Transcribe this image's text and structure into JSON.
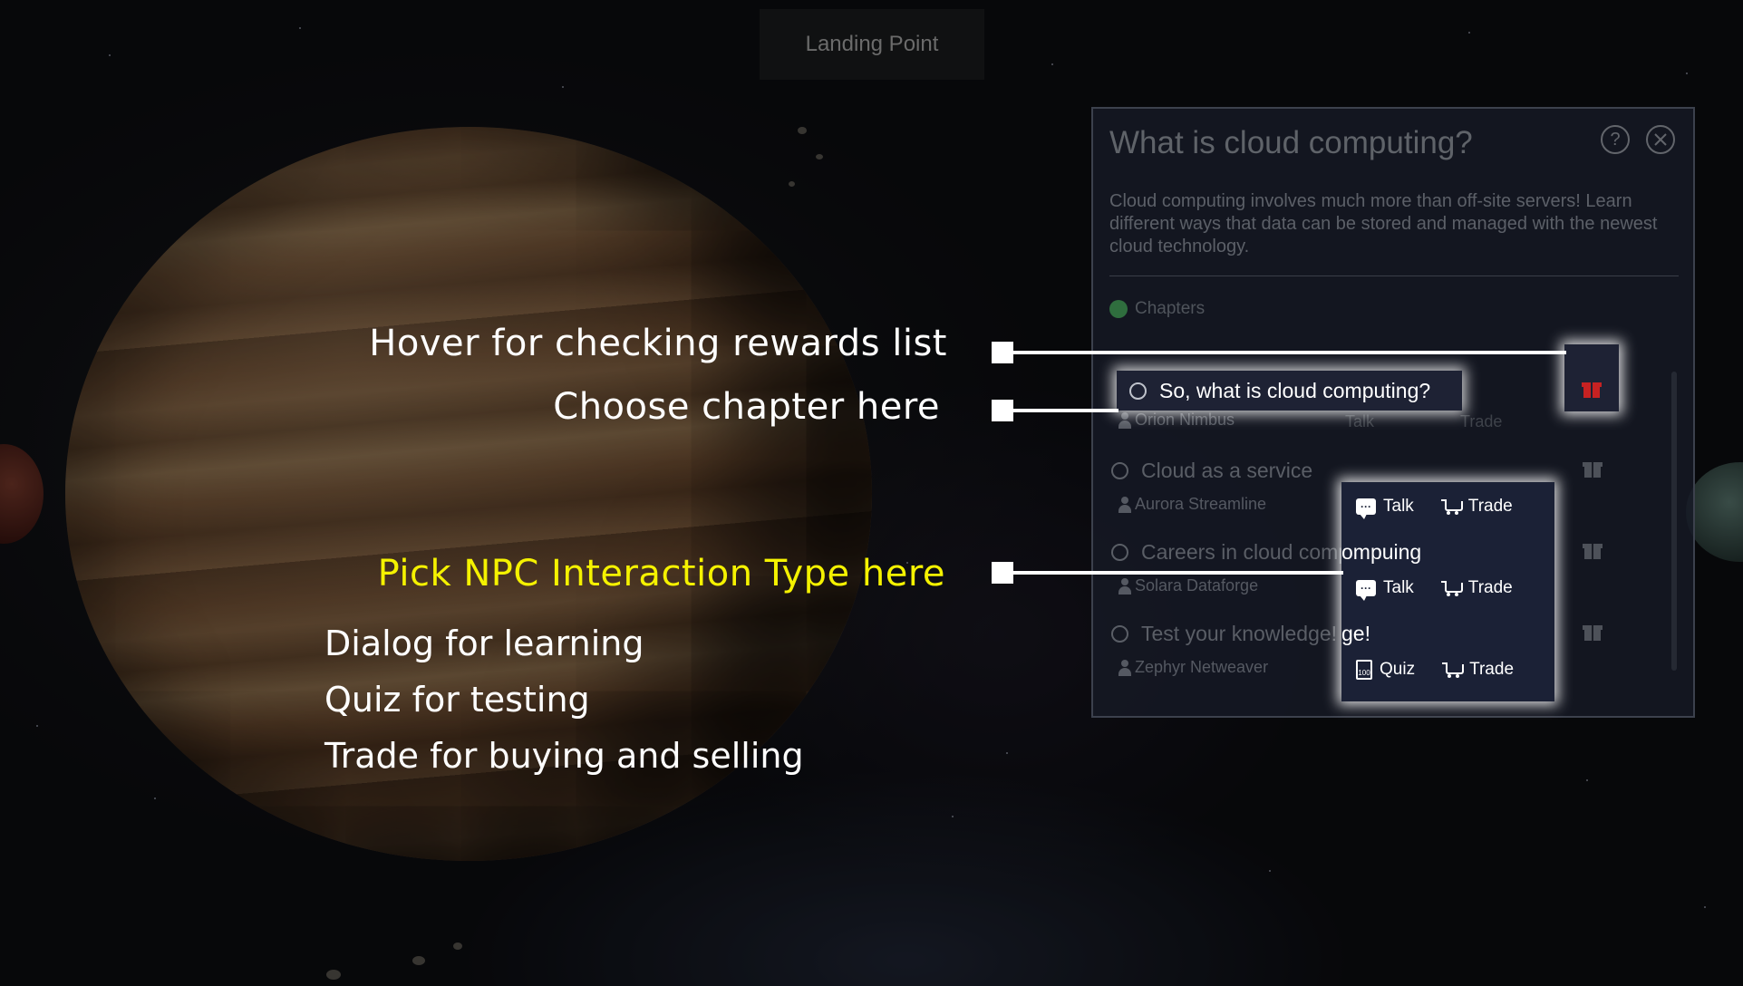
{
  "top_bar": {
    "location": "Landing Point"
  },
  "panel": {
    "title": "What is cloud computing?",
    "help_icon": "?",
    "description": "Cloud computing involves much more than off-site servers! Learn different ways that data can be stored and managed with the newest cloud technology.",
    "chapters_label": "Chapters",
    "chapters": [
      {
        "title": "So, what is cloud computing?",
        "npc": "Orion Nimbus",
        "actions": [
          "Talk",
          "Trade"
        ]
      },
      {
        "title": "Cloud as a service",
        "npc": "Aurora Streamline",
        "actions": [
          "Talk",
          "Trade"
        ]
      },
      {
        "title": "Careers in cloud computing",
        "npc": "Solara Dataforge",
        "actions": [
          "Talk",
          "Trade"
        ]
      },
      {
        "title": "Test your knowledge!",
        "npc": "Zephyr Netweaver",
        "actions": [
          "Quiz",
          "Trade"
        ]
      }
    ],
    "popup_spill": {
      "row2": "ompuing",
      "row3": "ge!"
    }
  },
  "callouts": {
    "rewards": "Hover for checking rewards list",
    "chapter": "Choose chapter here",
    "npc": "Pick NPC Interaction Type here",
    "lines": [
      "Dialog for learning",
      "Quiz for testing",
      "Trade for buying and selling"
    ]
  },
  "icons": {
    "talk": "speech-bubble",
    "trade": "shopping-cart",
    "quiz": "quiz-100-sheet",
    "gift": "gift-box",
    "close": "close-circle",
    "help": "question-circle"
  },
  "colors": {
    "callout_yellow": "#f5f200",
    "gift_highlight": "#c62222",
    "chapters_green": "#2f6e3e"
  }
}
